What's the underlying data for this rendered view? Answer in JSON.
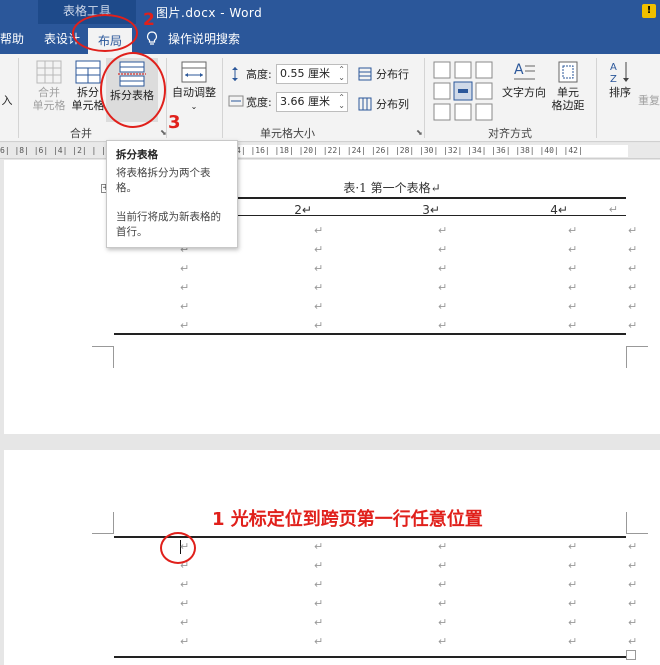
{
  "titlebar": {
    "context_tab": "表格工具",
    "document_title": "图片.docx - Word",
    "warning": "!"
  },
  "tabs": [
    {
      "label": "帮助"
    },
    {
      "label": "表设计"
    },
    {
      "label": "布局",
      "active": true
    },
    {
      "label": "操作说明搜索"
    }
  ],
  "ribbon": {
    "insert_partial": "入",
    "merge_cells": {
      "line1": "合并",
      "line2": "单元格"
    },
    "split_cells": {
      "line1": "拆分",
      "line2": "单元格"
    },
    "split_table": "拆分表格",
    "autofit": "自动调整",
    "height_label": "高度:",
    "height_value": "0.55 厘米",
    "width_label": "宽度:",
    "width_value": "3.66 厘米",
    "distribute_rows": "分布行",
    "distribute_cols": "分布列",
    "text_direction": "文字方向",
    "cell_margins": {
      "line1": "单元",
      "line2": "格边距"
    },
    "sort": "排序",
    "repeat_partial": "重复",
    "groups": {
      "merge": "合并",
      "cell_size": "单元格大小",
      "alignment": "对齐方式"
    }
  },
  "ruler": {
    "text": "6| |8| |6| |4| |2| |  |2| |4| |6| |8| |10| |12| |14| |16| |18| |20| |22| |24| |26| |28| |30| |32| |34| |36| |38| |40| |42|"
  },
  "tooltip": {
    "title": "拆分表格",
    "line1": "将表格拆分为两个表格。",
    "line2": "当前行将成为新表格的首行。"
  },
  "doc": {
    "caption": "表·1 第一个表格↵",
    "header": [
      "2↵",
      "3↵",
      "4↵"
    ],
    "mark": "↵"
  },
  "annotations": {
    "label1": "1 光标定位到跨页第一行任意位置",
    "label2": "2",
    "label3": "3"
  },
  "colors": {
    "word_blue": "#2b579a",
    "annotation_red": "#e0201b"
  }
}
